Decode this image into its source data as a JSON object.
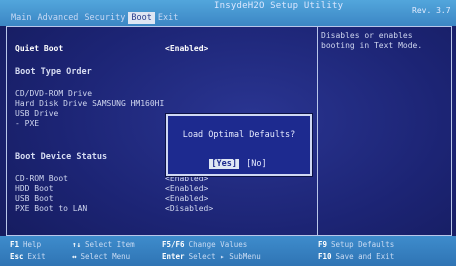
{
  "header": {
    "title": "InsydeH2O Setup Utility",
    "revision": "Rev. 3.7",
    "tabs": [
      "Main",
      "Advanced",
      "Security",
      "Boot",
      "Exit"
    ],
    "active_tab": "Boot"
  },
  "boot": {
    "quiet_boot_label": "Quiet Boot",
    "quiet_boot_value": "<Enabled>",
    "boot_type_order_heading": "Boot Type Order",
    "order": [
      "CD/DVD-ROM Drive",
      "Hard Disk Drive  SAMSUNG HM160HI",
      "USB Drive",
      "- PXE"
    ],
    "device_status_heading": "Boot Device Status",
    "devices": [
      {
        "label": "CD-ROM Boot",
        "value": "<Enabled>"
      },
      {
        "label": "HDD Boot",
        "value": "<Enabled>"
      },
      {
        "label": "USB Boot",
        "value": "<Enabled>"
      },
      {
        "label": "PXE Boot to LAN",
        "value": "<Disabled>"
      }
    ]
  },
  "help": {
    "text": "Disables or enables booting in Text Mode."
  },
  "dialog": {
    "message": "Load Optimal Defaults?",
    "yes": "[Yes]",
    "no": "[No]"
  },
  "footer": {
    "hotkeys": [
      {
        "key": "F1",
        "desc": "Help"
      },
      {
        "key": "↑↓",
        "desc": "Select Item"
      },
      {
        "key": "F5/F6",
        "desc": "Change Values"
      },
      {
        "key": "F9",
        "desc": "Setup Defaults"
      },
      {
        "key": "Esc",
        "desc": "Exit"
      },
      {
        "key": "↔",
        "desc": "Select Menu"
      },
      {
        "key": "Enter",
        "desc": "Select ▸ SubMenu"
      },
      {
        "key": "F10",
        "desc": "Save and Exit"
      }
    ]
  }
}
